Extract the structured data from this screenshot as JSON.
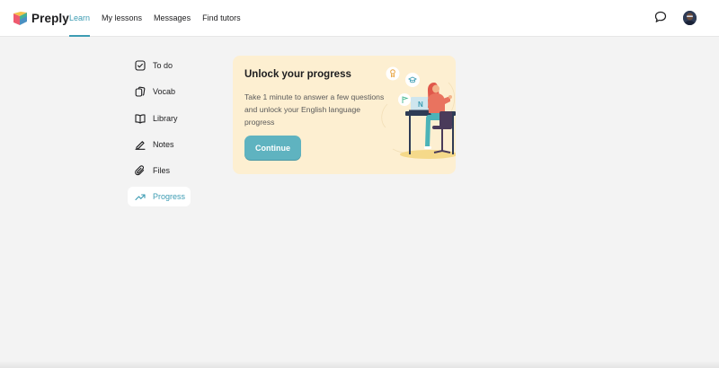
{
  "header": {
    "brand": "Preply",
    "nav": [
      {
        "label": "Learn",
        "active": true
      },
      {
        "label": "My lessons",
        "active": false
      },
      {
        "label": "Messages",
        "active": false
      },
      {
        "label": "Find tutors",
        "active": false
      }
    ],
    "icons": {
      "chat": "chat-bubble-icon",
      "avatar": "user-avatar"
    }
  },
  "sidebar": {
    "items": [
      {
        "label": "To do",
        "icon": "checkbox-icon",
        "active": false
      },
      {
        "label": "Vocab",
        "icon": "cards-icon",
        "active": false
      },
      {
        "label": "Library",
        "icon": "book-icon",
        "active": false
      },
      {
        "label": "Notes",
        "icon": "pencil-icon",
        "active": false
      },
      {
        "label": "Files",
        "icon": "paperclip-icon",
        "active": false
      },
      {
        "label": "Progress",
        "icon": "trend-up-icon",
        "active": true
      }
    ]
  },
  "card": {
    "title": "Unlock your progress",
    "text": "Take 1 minute to answer a few questions and unlock your English language progress",
    "button_label": "Continue"
  },
  "colors": {
    "accent": "#3d9cb3",
    "button": "#5fb3c0",
    "card_bg": "#fdefd1",
    "page_bg": "#f3f3f3"
  }
}
